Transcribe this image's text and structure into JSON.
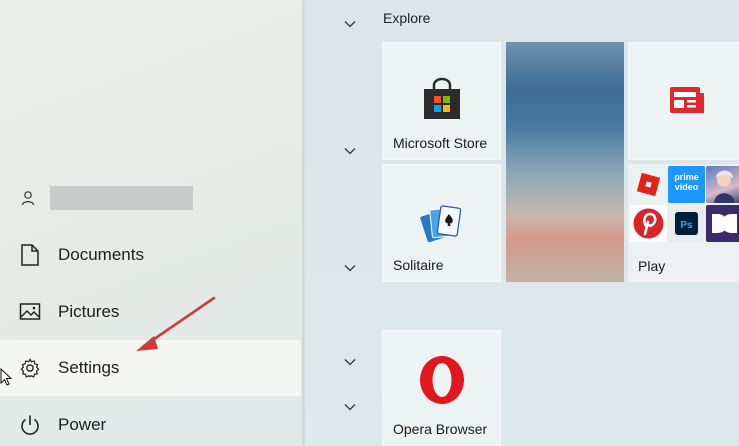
{
  "left_pane": {
    "nav_items": [
      {
        "id": "documents",
        "label": "Documents",
        "icon": "document-icon"
      },
      {
        "id": "pictures",
        "label": "Pictures",
        "icon": "pictures-icon"
      },
      {
        "id": "settings",
        "label": "Settings",
        "icon": "gear-icon"
      },
      {
        "id": "power",
        "label": "Power",
        "icon": "power-icon"
      }
    ]
  },
  "right_pane": {
    "group_title": "Explore",
    "tiles": {
      "microsoft_store": "Microsoft Store",
      "solitaire": "Solitaire",
      "play": "Play",
      "opera": "Opera Browser"
    },
    "play_minis": {
      "prime": "prime video"
    }
  },
  "colors": {
    "annotation_arrow": "#d23b3b",
    "opera_red": "#e0171c",
    "news_red": "#e2282e",
    "roblox_red": "#e2231a",
    "pinterest_red": "#d9242a",
    "prime_blue": "#1a98ff",
    "photoshop_navy": "#001e36"
  }
}
